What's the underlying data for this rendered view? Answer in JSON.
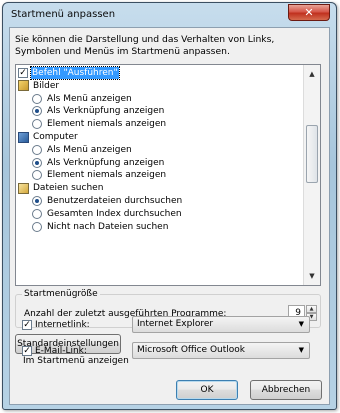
{
  "window": {
    "title": "Startmenü anpassen",
    "close_glyph": "✕"
  },
  "description": "Sie können die Darstellung und das Verhalten von Links, Symbolen und Menüs im Startmenü anpassen.",
  "list": {
    "items": [
      {
        "label": "Befehl \"Ausführen\"",
        "kind": "checkbox",
        "checked": true,
        "selected": true
      },
      {
        "label": "Bilder",
        "kind": "group",
        "icon": "pictures-folder-icon"
      },
      {
        "label": "Als Menü anzeigen",
        "kind": "radio",
        "checked": false
      },
      {
        "label": "Als Verknüpfung anzeigen",
        "kind": "radio",
        "checked": true
      },
      {
        "label": "Element niemals anzeigen",
        "kind": "radio",
        "checked": false
      },
      {
        "label": "Computer",
        "kind": "group",
        "icon": "computer-icon"
      },
      {
        "label": "Als Menü anzeigen",
        "kind": "radio",
        "checked": false
      },
      {
        "label": "Als Verknüpfung anzeigen",
        "kind": "radio",
        "checked": true
      },
      {
        "label": "Element niemals anzeigen",
        "kind": "radio",
        "checked": false
      },
      {
        "label": "Dateien suchen",
        "kind": "group",
        "icon": "search-files-icon"
      },
      {
        "label": "Benutzerdateien durchsuchen",
        "kind": "radio",
        "checked": true
      },
      {
        "label": "Gesamten Index durchsuchen",
        "kind": "radio",
        "checked": false
      },
      {
        "label": "Nicht nach Dateien suchen",
        "kind": "radio",
        "checked": false
      }
    ]
  },
  "size_group": {
    "title": "Startmenügröße",
    "count_label": "Anzahl der zuletzt ausgeführten Programme:",
    "count_value": "9"
  },
  "defaults_button": "Standardeinstellungen",
  "show_group": {
    "title": "Im Startmenü anzeigen",
    "internet": {
      "label": "Internetlink:",
      "checked": true,
      "value": "Internet Explorer"
    },
    "email": {
      "label": "E-Mail-Link:",
      "checked": true,
      "value": "Microsoft Office Outlook"
    }
  },
  "buttons": {
    "ok": "OK",
    "cancel": "Abbrechen"
  },
  "colors": {
    "selection": "#3399ff",
    "title_bar": "#a9c9df",
    "close_button": "#c0311f"
  }
}
